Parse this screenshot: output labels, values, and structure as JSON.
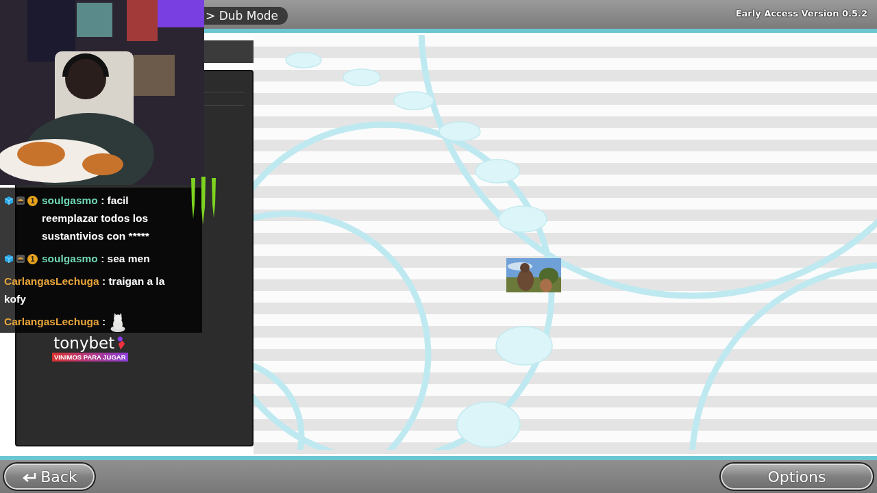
{
  "header": {
    "breadcrumb": "> Dub Mode",
    "version": "Early Access Version 0.5.2"
  },
  "stream_overlay": {
    "chat": [
      {
        "kind": "text",
        "user": "soulgasmo",
        "color": "#6fd6b4",
        "text": ": facil reemplazar todos los sustantivios con *****",
        "badges": [
          {
            "kind": "cube"
          },
          {
            "kind": "helmet"
          },
          {
            "kind": "count",
            "label": "1"
          }
        ]
      },
      {
        "kind": "text",
        "user": "soulgasmo",
        "color": "#6fd6b4",
        "text": ": sea men",
        "badges": [
          {
            "kind": "cube"
          },
          {
            "kind": "helmet"
          },
          {
            "kind": "count",
            "label": "1"
          }
        ]
      },
      {
        "kind": "text",
        "user": "CarlangasLechuga",
        "color": "#e9a53a",
        "text": ": traigan a la kofy"
      },
      {
        "kind": "emote",
        "user": "CarlangasLechuga",
        "color": "#e9a53a",
        "text": ":"
      }
    ],
    "sponsor": {
      "name": "tonybet",
      "tagline": "VINIMOS PARA JUGAR"
    }
  },
  "footer": {
    "buttons": [
      {
        "label": "Back",
        "kind": "back"
      },
      {
        "label": "Options",
        "kind": "plain"
      }
    ]
  }
}
